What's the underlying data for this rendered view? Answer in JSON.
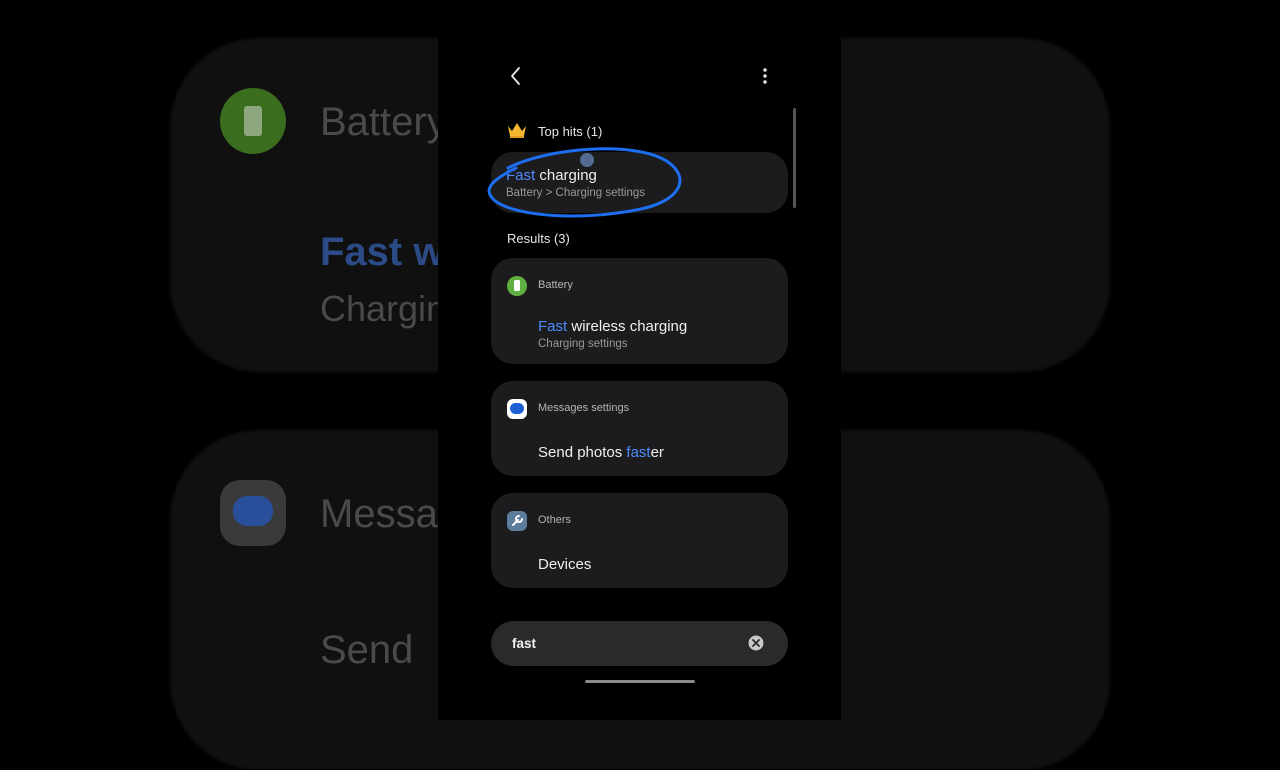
{
  "background": {
    "battery_label": "Battery",
    "fast_label": "Fast w",
    "charging_label": "Chargin",
    "messages_label": "Messag",
    "send_label": "Send"
  },
  "header": {
    "back_icon": "chevron-left-icon",
    "more_icon": "more-vertical-icon"
  },
  "top_hits": {
    "label": "Top hits (1)",
    "icon": "crown-icon",
    "item": {
      "highlight": "Fast",
      "title_rest": " charging",
      "subtitle": "Battery > Charging settings"
    }
  },
  "results": {
    "label": "Results (3)",
    "groups": [
      {
        "category": "Battery",
        "icon": "battery-icon",
        "icon_color": "#5fb041",
        "title_prefix": "",
        "highlight": "Fast",
        "title_suffix": " wireless charging",
        "subtitle": "Charging settings"
      },
      {
        "category": "Messages settings",
        "icon": "messages-icon",
        "icon_color": "#1f5fd6",
        "title_prefix": "Send photos ",
        "highlight": "fast",
        "title_suffix": "er"
      },
      {
        "category": "Others",
        "icon": "wrench-icon",
        "icon_color": "#5d7d9c",
        "title": "Devices"
      }
    ]
  },
  "search": {
    "value": "fast",
    "clear_icon": "clear-icon"
  },
  "colors": {
    "highlight": "#4d8cff",
    "annotation": "#1d6ff2",
    "card": "#1c1c1e"
  }
}
